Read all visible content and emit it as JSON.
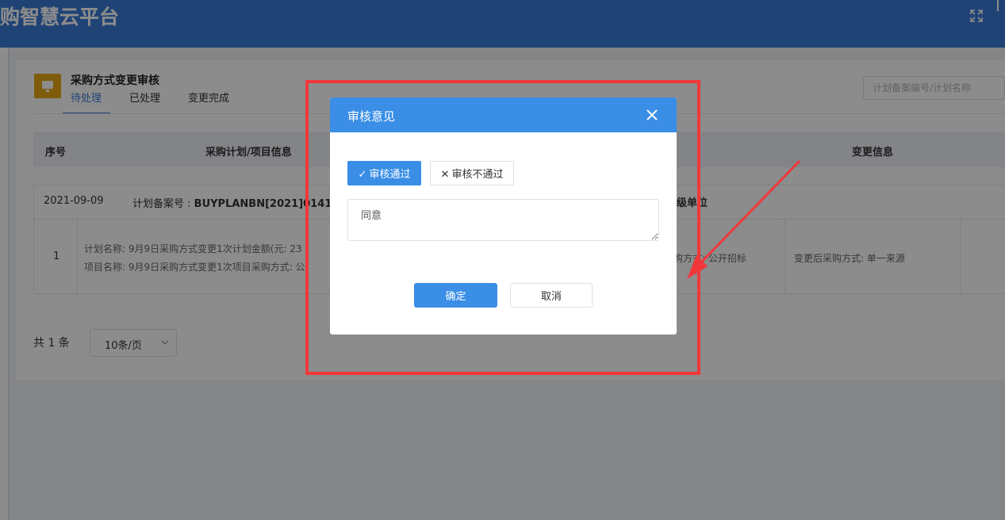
{
  "header": {
    "app_title": "购智慧云平台",
    "fullscreen_icon": "fullscreen-icon"
  },
  "page": {
    "title": "采购方式变更审核",
    "tabs": [
      {
        "label": "待处理",
        "active": true
      },
      {
        "label": "已处理",
        "active": false
      },
      {
        "label": "变更完成",
        "active": false
      }
    ],
    "search_placeholder": "计划备案编号/计划名称"
  },
  "table": {
    "columns": [
      "序号",
      "采购计划/项目信息",
      "变更信息"
    ],
    "groups": [
      {
        "date": "2021-09-09",
        "plan_prefix": "计划备案号 : ",
        "plan_no": "BUYPLANBN[2021]01414",
        "unit_label": "级单位",
        "rows": [
          {
            "index": "1",
            "line1": "计划名称: 9月9日采购方式变更1次计划金额(元",
            "line1_tail": ": 23",
            "line2": "项目名称: 9月9日采购方式变更1次项目采购方",
            "line2_tail": "式: 公",
            "method": "购方式: 公开招标",
            "change": "变更后采购方式: 单一来源"
          }
        ]
      }
    ]
  },
  "pager": {
    "total": "共 1 条",
    "page_size": "10条/页"
  },
  "dialog": {
    "title": "审核意见",
    "pass_label": "审核通过",
    "reject_label": "审核不通过",
    "opinion_value": "同意",
    "ok_label": "确定",
    "cancel_label": "取消"
  },
  "colors": {
    "header_bg": "#3a7bd5",
    "dialog_header": "#3a8ee6",
    "annotation": "#f0383a",
    "icon_bg": "#e6a817"
  }
}
